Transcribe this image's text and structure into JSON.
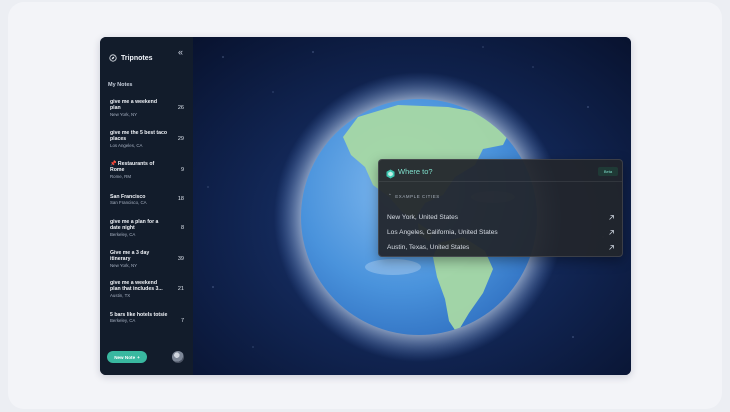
{
  "app": {
    "name": "Tripnotes"
  },
  "sidebar": {
    "section_title": "My Notes",
    "notes": [
      {
        "title": "give me a weekend plan",
        "location": "New York, NY",
        "count": "26"
      },
      {
        "title": "give me the 5 best taco places",
        "location": "Los Angeles, CA",
        "count": "29"
      },
      {
        "title": "📌 Restaurants of Rome",
        "location": "Rome, RM",
        "count": "9"
      },
      {
        "title": "San Francisco",
        "location": "San Francisco, CA",
        "count": "18"
      },
      {
        "title": "give me a plan for a date night",
        "location": "Berkeley, CA",
        "count": "8"
      },
      {
        "title": "Give me a 3 day itinerary",
        "location": "New York, NY",
        "count": "39"
      },
      {
        "title": "give me a weekend plan that includes 3...",
        "location": "Austin, TX",
        "count": "21"
      },
      {
        "title": "5 bars like hotels totsie",
        "location": "Berkeley, CA",
        "count": "7"
      }
    ],
    "new_note_label": "New Note"
  },
  "search": {
    "placeholder": "Where to?",
    "button_label": "Beta",
    "examples_label": "EXAMPLE CITIES",
    "cities": [
      "New York, United States",
      "Los Angeles, California, United States",
      "Austin, Texas, United States"
    ]
  },
  "icons": {
    "brand": "compass-icon",
    "collapse": "chevrons-left-icon",
    "search": "hexagon-icon",
    "new_note": "plus-icon",
    "city_arrow": "arrow-up-right-icon"
  },
  "colors": {
    "accent": "#39b8a0",
    "sidebar_bg": "#121c2b",
    "space_bg": "#0b1738",
    "ocean": "#3a82cf",
    "land": "#9fd3a0"
  }
}
